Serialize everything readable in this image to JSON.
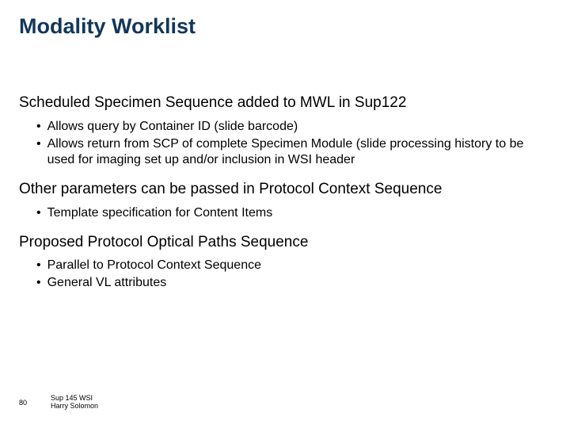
{
  "title": "Modality Worklist",
  "sections": [
    {
      "heading": "Scheduled Specimen Sequence added to MWL in Sup122",
      "bullets": [
        "Allows query by Container ID (slide barcode)",
        "Allows return from SCP of complete Specimen Module (slide processing history to be used for imaging set up and/or inclusion in WSI header"
      ]
    },
    {
      "heading": "Other parameters can be passed in Protocol Context Sequence",
      "bullets": [
        "Template specification for Content Items"
      ]
    },
    {
      "heading": "Proposed Protocol Optical Paths Sequence",
      "bullets": [
        "Parallel to  Protocol Context Sequence",
        "General VL attributes"
      ]
    }
  ],
  "footer": {
    "page": "80",
    "line1": "Sup 145 WSI",
    "line2": "Harry Solomon"
  }
}
